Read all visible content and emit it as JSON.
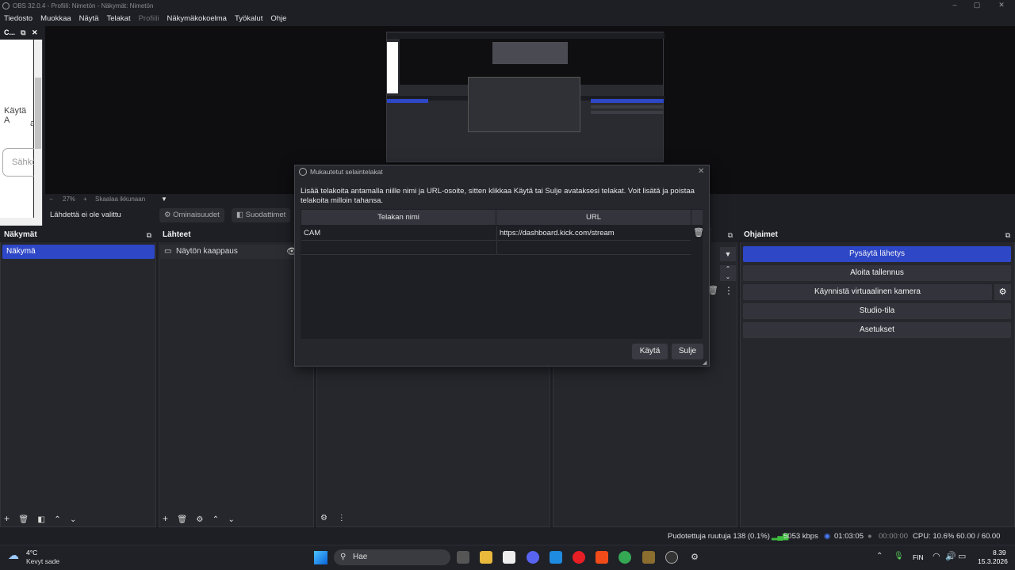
{
  "window": {
    "title": "OBS 32.0.4 - Profiili: Nimetön - Näkymät: Nimetön",
    "controls": [
      "–",
      "▢",
      "✕"
    ]
  },
  "menu": [
    "Tiedosto",
    "Muokkaa",
    "Näytä",
    "Telakat",
    "Profiili",
    "Näkymäkokoelma",
    "Työkalut",
    "Ohje"
  ],
  "left_dock": {
    "title": "C...",
    "text1": "Käytä A",
    "text2": "a",
    "input": "Sähkö"
  },
  "preview_status": {
    "zoom": "27%",
    "minus": "−",
    "plus": "+",
    "scale": "Skaalaa ikkunaan"
  },
  "toolbar": {
    "no_source": "Lähdettä ei ole valittu",
    "properties": "Ominaisuudet",
    "filters": "Suodattimet"
  },
  "panels": {
    "scenes": {
      "title": "Näkymät",
      "items": [
        "Näkymä"
      ]
    },
    "sources": {
      "title": "Lähteet",
      "items": [
        "Näytön kaappaus"
      ]
    },
    "controls": {
      "title": "Ohjaimet",
      "buttons": [
        "Pysäytä lähetys",
        "Aloita tallennus",
        "Käynnistä virtuaalinen kamera",
        "Studio-tila",
        "Asetukset"
      ]
    }
  },
  "dialog": {
    "title": "Mukautetut selaintelakat",
    "description": "Lisää telakoita antamalla niille nimi ja URL-osoite, sitten klikkaa Käytä tai Sulje avataksesi telakat. Voit lisätä ja poistaa telakoita milloin tahansa.",
    "headers": [
      "Telakan nimi",
      "URL"
    ],
    "rows": [
      {
        "name": "CAM",
        "url": "https://dashboard.kick.com/stream"
      }
    ],
    "apply": "Käytä",
    "close": "Sulje"
  },
  "status": {
    "dropped": "Pudotettuja ruutuja 138 (0.1%)",
    "bitrate": "5053 kbps",
    "stream_time": "01:03:05",
    "rec_time": "00:00:00",
    "cpu": "CPU: 10.6%",
    "fps": "60.00 / 60.00 FPS"
  },
  "taskbar": {
    "temp": "4°C",
    "weather": "Kevyt sade",
    "search": "Hae",
    "lang": "FIN",
    "time": "8.39",
    "date": "15.3.2026"
  },
  "colors": {
    "accent": "#2e47c7",
    "background": "#1e1f24",
    "panel": "#26272c"
  }
}
